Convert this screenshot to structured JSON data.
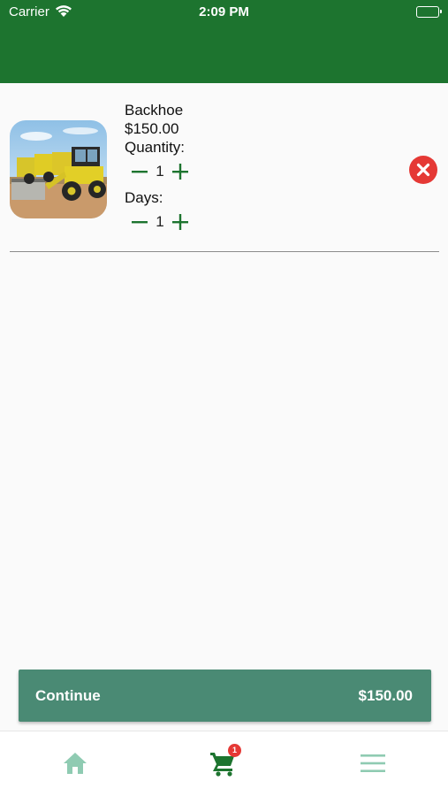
{
  "status_bar": {
    "carrier": "Carrier",
    "time": "2:09 PM"
  },
  "cart": {
    "items": [
      {
        "name": "Backhoe",
        "price": "$150.00",
        "quantity_label": "Quantity:",
        "quantity": "1",
        "days_label": "Days:",
        "days": "1",
        "image_icon": "backhoe-photo"
      }
    ]
  },
  "footer": {
    "continue_label": "Continue",
    "total": "$150.00"
  },
  "nav": {
    "cart_badge": "1",
    "items": [
      "home-icon",
      "cart-icon",
      "menu-icon"
    ]
  },
  "colors": {
    "appbar": "#1d742f",
    "accent_green": "#1d742f",
    "continue_button": "#4a8a74",
    "inactive_nav": "#8fcbb2",
    "remove_red": "#e53935",
    "background": "#fafafa"
  }
}
